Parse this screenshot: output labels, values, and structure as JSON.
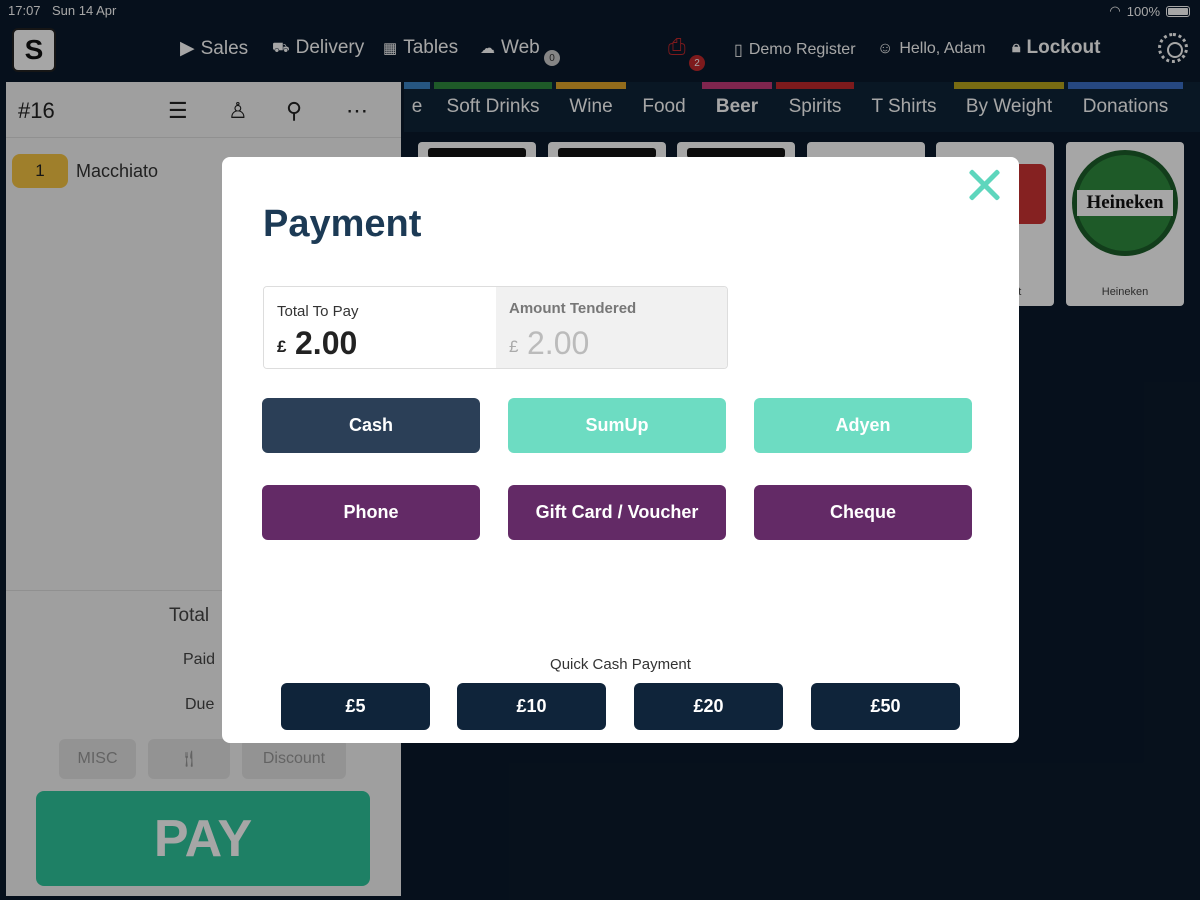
{
  "status_bar": {
    "time": "17:07",
    "date": "Sun 14 Apr",
    "battery": "100%"
  },
  "nav": {
    "logo": "S",
    "sales": "Sales",
    "delivery": "Delivery",
    "tables": "Tables",
    "web": "Web",
    "web_badge": "0",
    "printer_badge": "2",
    "register": "Demo Register",
    "greeting": "Hello, Adam",
    "lockout": "Lockout"
  },
  "order": {
    "number": "#16",
    "items": [
      {
        "qty": "1",
        "name": "Macchiato"
      }
    ],
    "total_label": "Total",
    "paid_label": "Paid",
    "due_label": "Due",
    "misc_label": "MISC",
    "discount_label": "Discount",
    "pay_label": "PAY"
  },
  "categories": [
    {
      "label": "e",
      "color": "#3b84c7"
    },
    {
      "label": "Soft Drinks",
      "color": "#2e8b3e"
    },
    {
      "label": "Wine",
      "color": "#e0a52a"
    },
    {
      "label": "Food",
      "color": "#0e2438"
    },
    {
      "label": "Beer",
      "color": "#c33a78",
      "active": true
    },
    {
      "label": "Spirits",
      "color": "#c0282b"
    },
    {
      "label": "T Shirts",
      "color": "#0e2438"
    },
    {
      "label": "By Weight",
      "color": "#b8a51c"
    },
    {
      "label": "Donations",
      "color": "#3b6fc7"
    }
  ],
  "products": [
    {
      "label": ""
    },
    {
      "label": ""
    },
    {
      "label": ""
    },
    {
      "label": ""
    },
    {
      "label": "ght"
    },
    {
      "label": "Heineken",
      "logo_text": "Heineken"
    }
  ],
  "payment": {
    "title": "Payment",
    "total_label": "Total To Pay",
    "currency": "£",
    "total_value": "2.00",
    "tendered_label": "Amount Tendered",
    "tendered_value": "2.00",
    "methods": [
      {
        "label": "Cash",
        "color": "#2b3f57"
      },
      {
        "label": "SumUp",
        "color": "#6ddcc2"
      },
      {
        "label": "Adyen",
        "color": "#6ddcc2"
      },
      {
        "label": "Phone",
        "color": "#632a66"
      },
      {
        "label": "Gift Card / Voucher",
        "color": "#632a66"
      },
      {
        "label": "Cheque",
        "color": "#632a66"
      }
    ],
    "quick_label": "Quick Cash Payment",
    "quick_amounts": [
      "£5",
      "£10",
      "£20",
      "£50"
    ]
  }
}
